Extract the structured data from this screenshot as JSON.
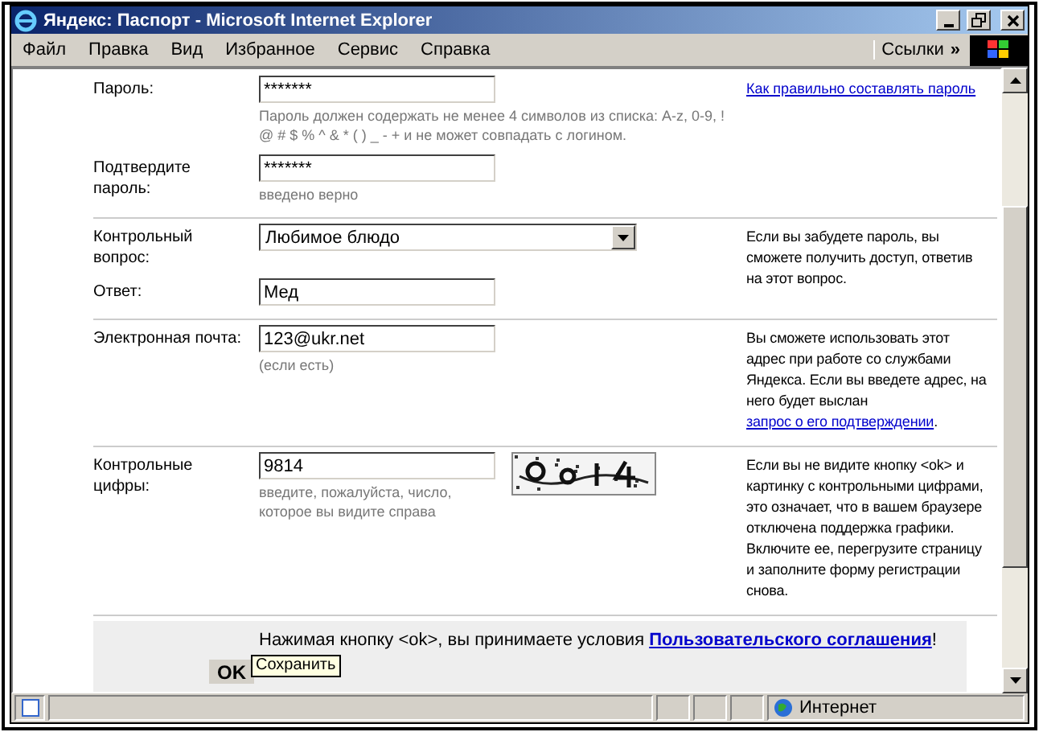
{
  "window": {
    "title": "Яндекс: Паспорт - Microsoft Internet Explorer"
  },
  "menu": [
    "Файл",
    "Правка",
    "Вид",
    "Избранное",
    "Сервис",
    "Справка"
  ],
  "links": {
    "label": "Ссылки",
    "chevron": "»"
  },
  "sections": [
    {
      "rows": [
        {
          "label": "Пароль:",
          "field": {
            "kind": "input",
            "value": "*******"
          },
          "hint": "Пароль должен содержать не менее 4 символов из списка: A-z, 0-9, ! @ # $ % ^ & * ( ) _ - + и не может совпадать с логином."
        },
        {
          "label": "Подтвердите пароль:",
          "field": {
            "kind": "input",
            "value": "*******"
          },
          "hint": "введено верно"
        }
      ],
      "note": {
        "link": "Как правильно составлять пароль"
      }
    },
    {
      "rows": [
        {
          "label": "Контрольный вопрос:",
          "field": {
            "kind": "select",
            "value": "Любимое блюдо"
          }
        },
        {
          "label": "Ответ:",
          "field": {
            "kind": "input",
            "value": "Мед"
          }
        }
      ],
      "note": {
        "text": "Если вы забудете пароль, вы сможете получить доступ, ответив на этот вопрос."
      }
    },
    {
      "rows": [
        {
          "label": "Электронная почта:",
          "field": {
            "kind": "input",
            "value": "123@ukr.net"
          },
          "hint": "(если есть)"
        }
      ],
      "note": {
        "text": "Вы сможете использовать этот адрес при работе со службами Яндекса. Если вы введете адрес, на него будет выслан ",
        "link": "запрос о его подтверждении",
        "after": "."
      }
    },
    {
      "rows": [
        {
          "label": "Контрольные цифры:",
          "field": {
            "kind": "captcha",
            "value": "9814"
          },
          "hint": "введите, пожалуйста, число, которое вы видите справа"
        }
      ],
      "note": {
        "text": "Если вы не видите кнопку <ok> и картинку с контрольными цифрами, это означает, что в вашем браузере отключена поддержка графики. Включите ее, перегрузите страницу и заполните форму регистрации снова."
      }
    }
  ],
  "agreement": {
    "text": "Нажимая кнопку <ok>, вы принимаете условия ",
    "link": "Пользовательского соглашения",
    "after": "!"
  },
  "ok_button": "OK",
  "tooltip": "Сохранить",
  "status_bar": {
    "zone": "Интернет"
  }
}
